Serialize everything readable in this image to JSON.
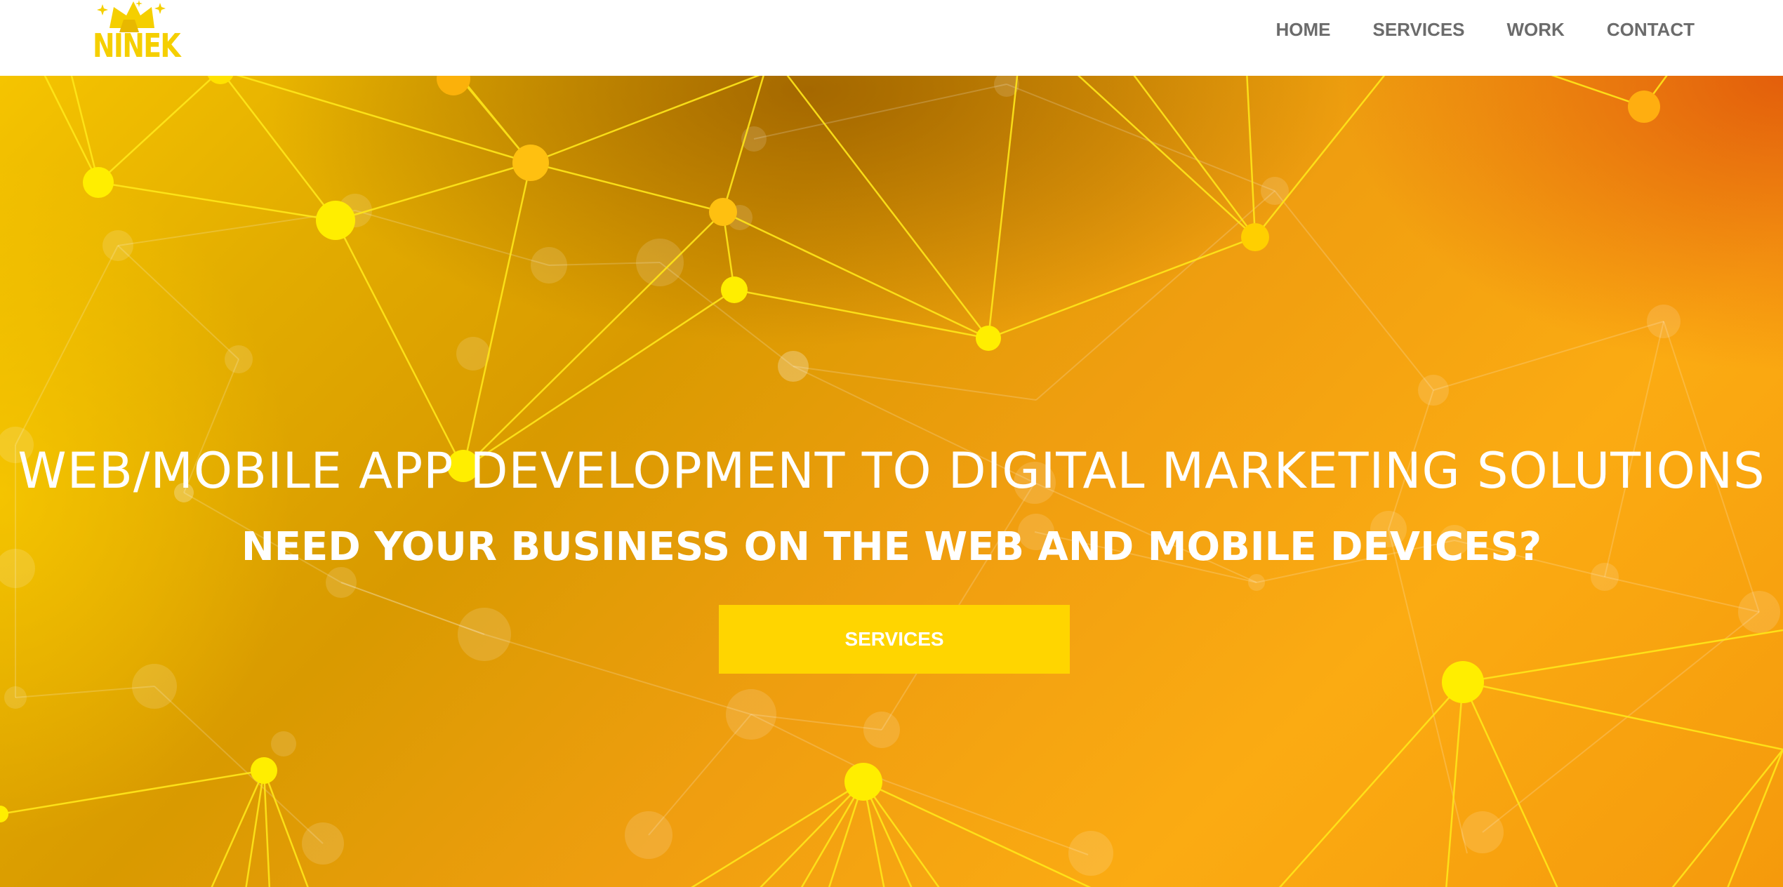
{
  "brand": {
    "logo_text": "NINEK",
    "logo_color": "#f5cf00"
  },
  "nav": {
    "items": [
      {
        "label": "HOME"
      },
      {
        "label": "SERVICES"
      },
      {
        "label": "WORK"
      },
      {
        "label": "CONTACT"
      }
    ],
    "text_color": "#6b6b6b"
  },
  "hero": {
    "headline": "WEB/MOBILE APP DEVELOPMENT TO DIGITAL MARKETING SOLUTIONS",
    "subheadline": "NEED YOUR BUSINESS ON THE WEB AND MOBILE DEVICES?",
    "cta_label": "SERVICES",
    "cta_color": "#ffd500",
    "background_colors": [
      "#f5c400",
      "#d99a00",
      "#fbab12",
      "#e0520a"
    ],
    "node_color": "#ffee00",
    "line_color": "#ffe500"
  }
}
